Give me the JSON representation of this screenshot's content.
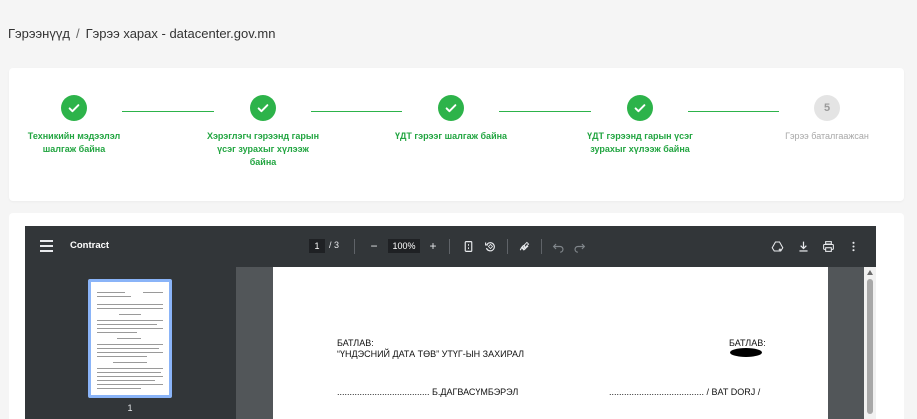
{
  "breadcrumb": {
    "root": "Гэрээнүүд",
    "separator": "/",
    "current": "Гэрээ харах - datacenter.gov.mn"
  },
  "stepper": {
    "steps": [
      {
        "label": "Техникийн мэдээлэл шалгаж байна",
        "status": "done",
        "icon": "check-icon"
      },
      {
        "label": "Хэрэглэгч гэрээнд гарын үсэг зурахыг хүлээж байна",
        "status": "done",
        "icon": "check-icon"
      },
      {
        "label": "ҮДТ гэрээг шалгаж байна",
        "status": "done",
        "icon": "check-icon"
      },
      {
        "label": "ҮДТ гэрээнд гарын үсэг зурахыг хүлээж байна",
        "status": "done",
        "icon": "check-icon"
      },
      {
        "label": "Гэрээ баталгаажсан",
        "status": "pending",
        "number": "5"
      }
    ],
    "colors": {
      "done": "#2db34a",
      "pending": "#e4e4e4"
    }
  },
  "pdf_viewer": {
    "title": "Contract",
    "current_page": "1",
    "page_separator": "/",
    "total_pages": "3",
    "zoom_out_label": "−",
    "zoom": "100%",
    "zoom_in_label": "+",
    "thumbnail_page": "1",
    "toolbar_icons": [
      "menu-icon",
      "zoom-out-icon",
      "zoom-in-icon",
      "fit-page-icon",
      "rotate-icon",
      "draw-icon",
      "undo-icon",
      "redo-icon",
      "drive-icon",
      "download-icon",
      "print-icon",
      "more-vert-icon"
    ]
  },
  "document": {
    "left_approve": "БАТЛАВ:",
    "left_org": "“ҮНДЭСНИЙ ДАТА ТӨВ” УТҮГ-ЫН ЗАХИРАЛ",
    "left_signature": "..................................... Б.ДАГВАСҮМБЭРЭЛ",
    "right_approve": "БАТЛАВ:",
    "right_signature": "...................................... / BAT DORJ /"
  }
}
